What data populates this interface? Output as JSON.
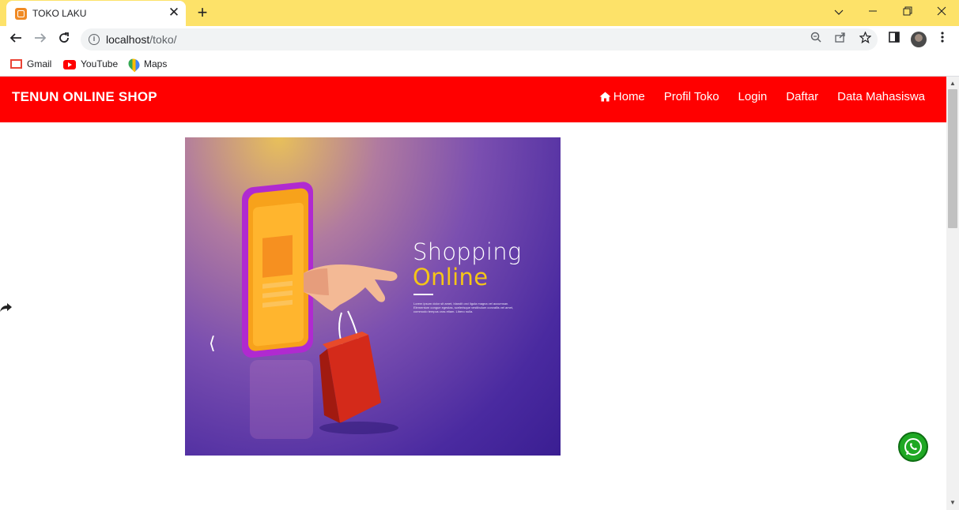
{
  "browser": {
    "tab_title": "TOKO LAKU",
    "tab_close_label": "✕",
    "new_tab_label": "+",
    "url_host": "localhost",
    "url_path": "/toko/",
    "bookmarks": [
      {
        "label": "Gmail",
        "icon": "gmail-icon"
      },
      {
        "label": "YouTube",
        "icon": "youtube-icon"
      },
      {
        "label": "Maps",
        "icon": "maps-icon"
      }
    ]
  },
  "navbar": {
    "brand": "TENUN ONLINE SHOP",
    "items": [
      "Home",
      "Profil Toko",
      "Login",
      "Daftar",
      "Data Mahasiswa"
    ],
    "color": "#ff0000"
  },
  "carousel": {
    "title_line1": "Shopping",
    "title_line2": "Online",
    "body_text": "Lorem ipsum dolor sit amet, blandit orci ligula magna vel accumsan. Elementum congue egestas, scelerisque vestibulum convallis vel amet, commodo tempus cras etiam. Libero nulla.",
    "prev_label": "⟨"
  },
  "floating": {
    "whatsapp_icon": "whatsapp-icon",
    "share_icon": "share-icon"
  }
}
